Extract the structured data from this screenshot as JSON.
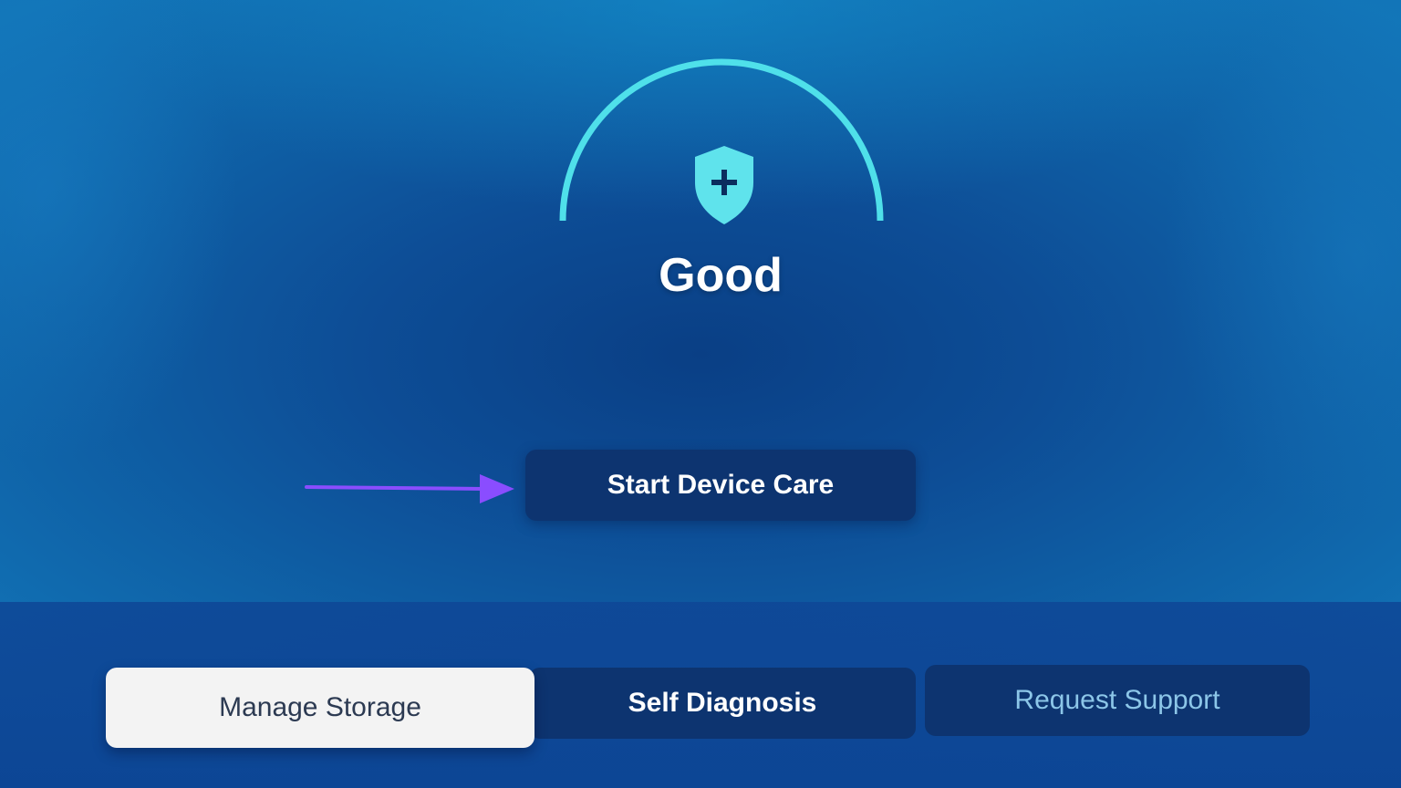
{
  "device_care": {
    "status_label": "Good",
    "shield_icon": "shield-plus-icon",
    "start_button_label": "Start Device Care"
  },
  "bottom_nav": {
    "items": [
      {
        "label": "Manage Storage",
        "state": "focused"
      },
      {
        "label": "Self Diagnosis",
        "state": "default"
      },
      {
        "label": "Request Support",
        "state": "default"
      }
    ]
  },
  "colors": {
    "background": "#0d4d96",
    "gauge_arc": "#4fe0ea",
    "shield": "#5fe3ec",
    "button_bg": "#0d3470",
    "focused_button_bg": "#f3f3f3",
    "muted_text": "#8cc6e8",
    "annotation_arrow": "#8a4dff"
  }
}
